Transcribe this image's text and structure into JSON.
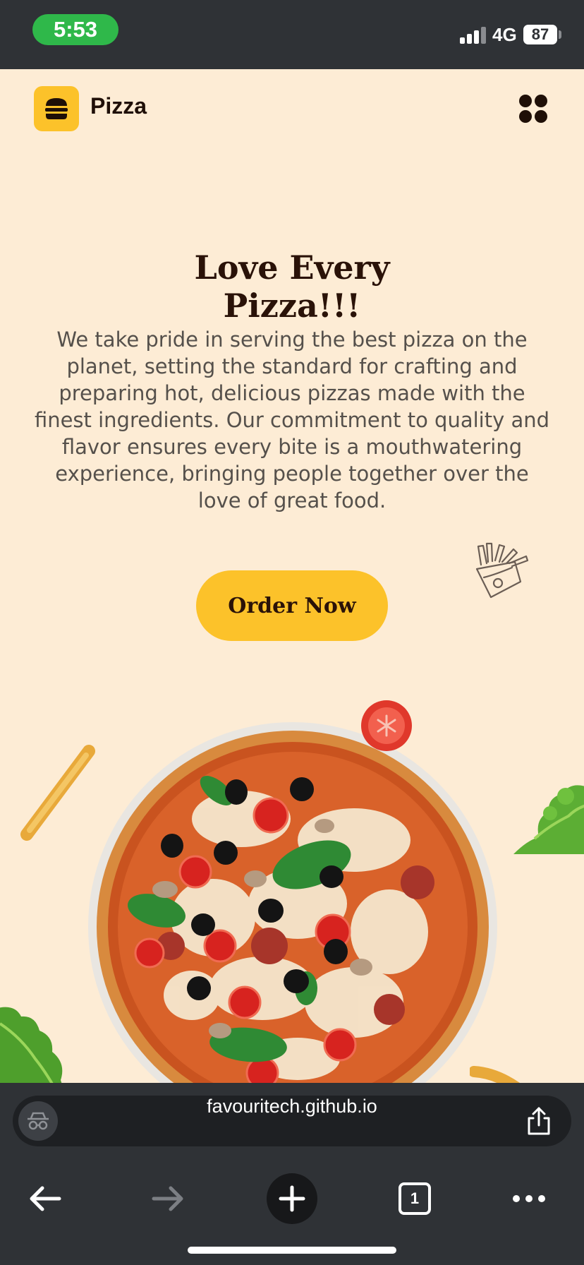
{
  "status_bar": {
    "time": "5:53",
    "network": "4G",
    "battery": "87"
  },
  "header": {
    "brand": "Pizza",
    "logo_icon": "burger-icon",
    "menu_icon": "four-dots-menu-icon"
  },
  "hero": {
    "title_line1": "Love Every",
    "title_line2": "Pizza!!!",
    "description": "We take pride in serving the best pizza on the planet, setting the standard for crafting and preparing hot, delicious pizzas made with the finest ingredients. Our commitment to quality and flavor ensures every bite is a mouthwatering experience, bringing people together over the love of great food.",
    "cta_label": "Order Now"
  },
  "browser": {
    "url": "favouritech.github.io",
    "tab_count": "1"
  },
  "colors": {
    "page_background": "#fdecd5",
    "accent_yellow": "#fcc22a",
    "heading_dark": "#2a1208",
    "status_green": "#2fb84a",
    "chrome_dark": "#2f3236"
  }
}
